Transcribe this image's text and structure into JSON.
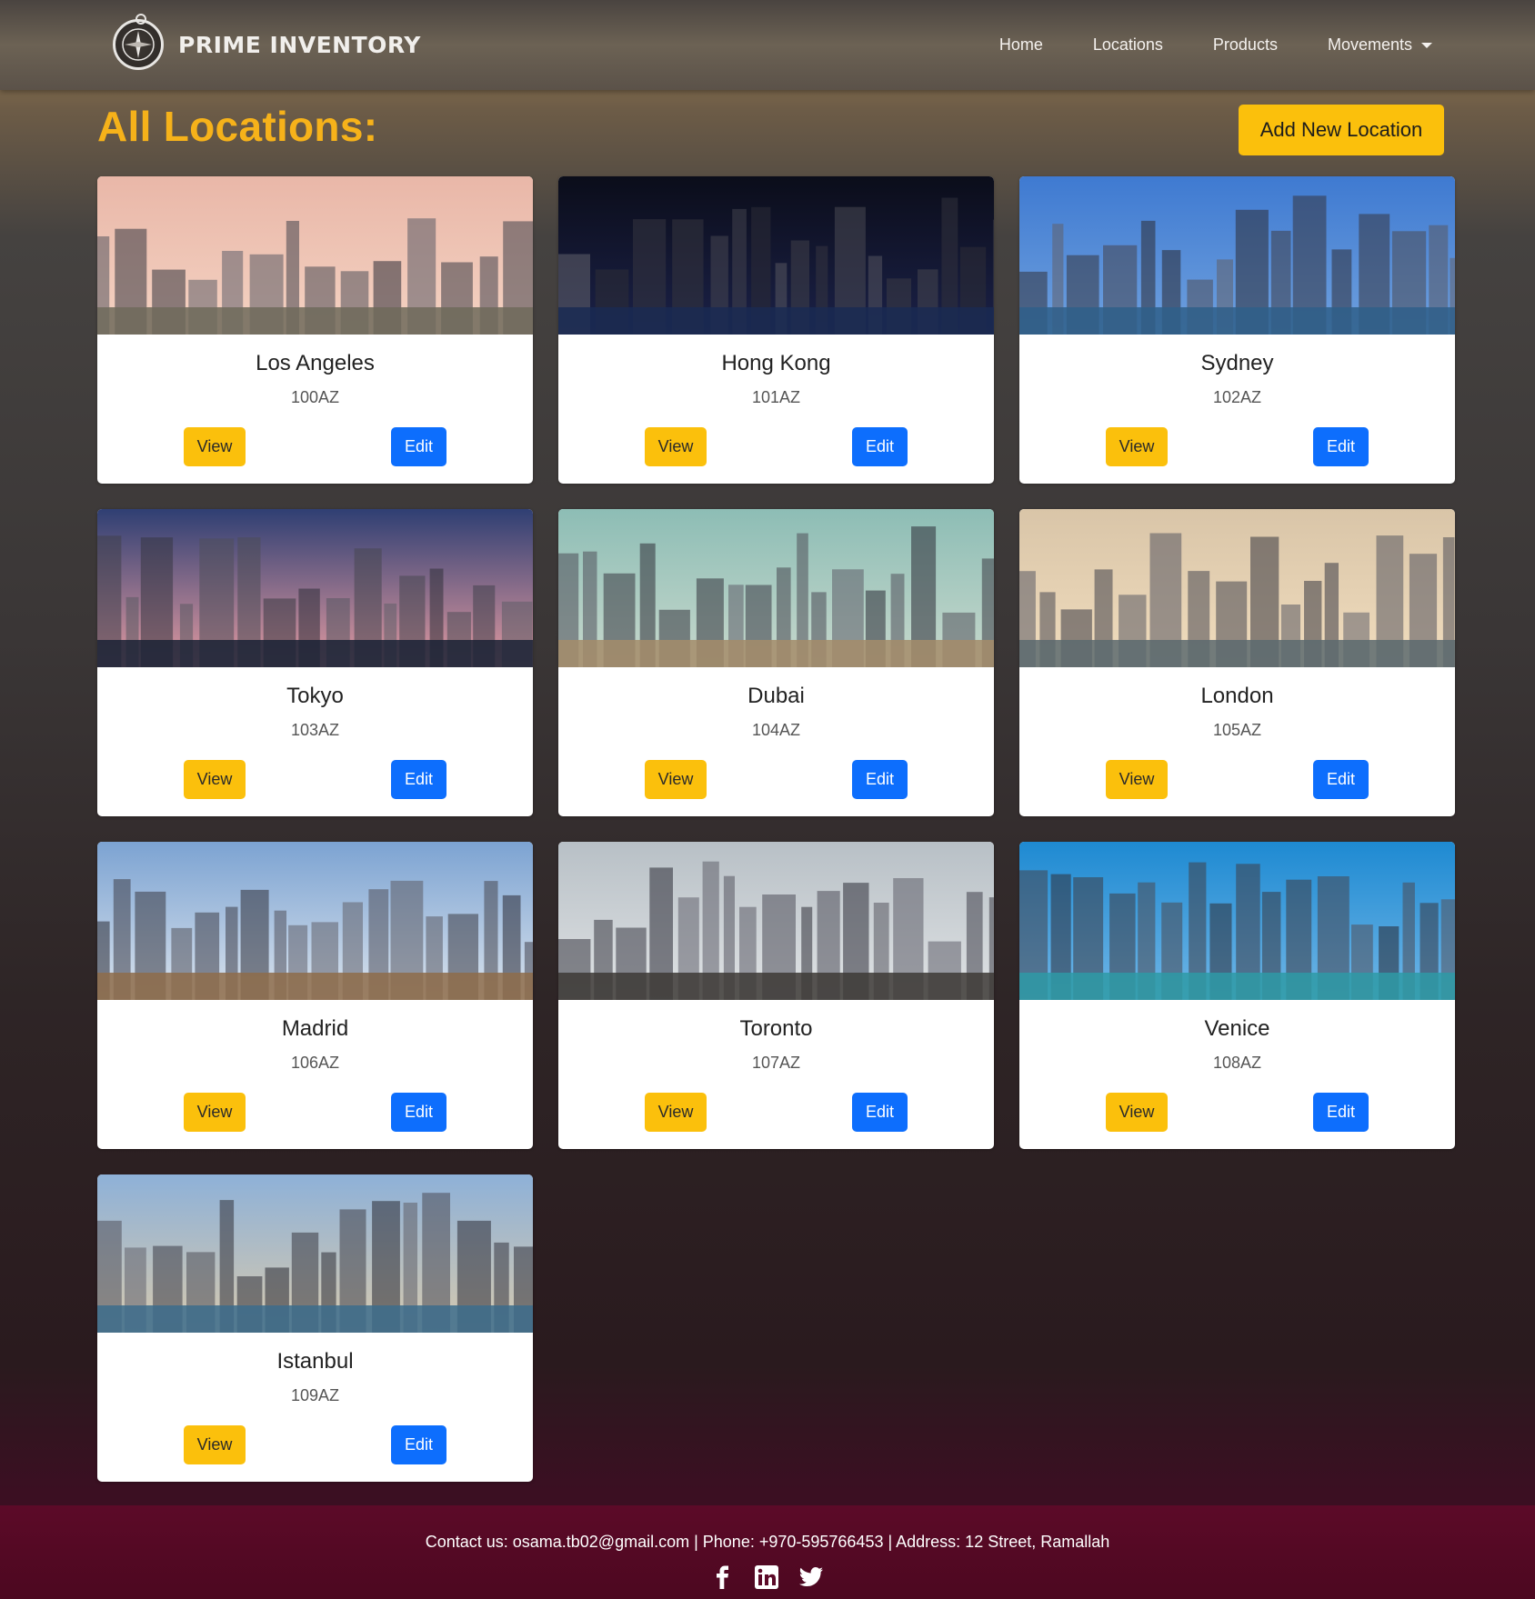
{
  "navbar": {
    "brand": "PRIME INVENTORY",
    "links": [
      {
        "label": "Home"
      },
      {
        "label": "Locations"
      },
      {
        "label": "Products"
      },
      {
        "label": "Movements"
      }
    ]
  },
  "header": {
    "title": "All Locations:",
    "add_button": "Add New Location"
  },
  "locations": [
    {
      "name": "Los Angeles",
      "code": "100AZ",
      "view": "View",
      "edit": "Edit",
      "sky": "#e9b7a8",
      "sky2": "#f4d2c2",
      "ground": "#6f6a5a"
    },
    {
      "name": "Hong Kong",
      "code": "101AZ",
      "view": "View",
      "edit": "Edit",
      "sky": "#0b0d1a",
      "sky2": "#1b2148",
      "ground": "#1a2a52"
    },
    {
      "name": "Sydney",
      "code": "102AZ",
      "view": "View",
      "edit": "Edit",
      "sky": "#3f7ad1",
      "sky2": "#6ea0de",
      "ground": "#2f5f8a"
    },
    {
      "name": "Tokyo",
      "code": "103AZ",
      "view": "View",
      "edit": "Edit",
      "sky": "#2f3f73",
      "sky2": "#e39aa0",
      "ground": "#1a2235"
    },
    {
      "name": "Dubai",
      "code": "104AZ",
      "view": "View",
      "edit": "Edit",
      "sky": "#8dbdb5",
      "sky2": "#c7d8cc",
      "ground": "#a48c6a"
    },
    {
      "name": "London",
      "code": "105AZ",
      "view": "View",
      "edit": "Edit",
      "sky": "#d9c5a8",
      "sky2": "#f0dcbd",
      "ground": "#5c6a6e"
    },
    {
      "name": "Madrid",
      "code": "106AZ",
      "view": "View",
      "edit": "Edit",
      "sky": "#7ca3d2",
      "sky2": "#d9e2ec",
      "ground": "#8e6c4a"
    },
    {
      "name": "Toronto",
      "code": "107AZ",
      "view": "View",
      "edit": "Edit",
      "sky": "#b8c0c6",
      "sky2": "#dfe2e4",
      "ground": "#3d3a36"
    },
    {
      "name": "Venice",
      "code": "108AZ",
      "view": "View",
      "edit": "Edit",
      "sky": "#1e8ad2",
      "sky2": "#6fb5e6",
      "ground": "#2e9aa6"
    },
    {
      "name": "Istanbul",
      "code": "109AZ",
      "view": "View",
      "edit": "Edit",
      "sky": "#8eb1d8",
      "sky2": "#d6c9ae",
      "ground": "#3c6c8c"
    }
  ],
  "footer": {
    "contact": "Contact us: osama.tb02@gmail.com | Phone: +970-595766453 | Address: 12 Street, Ramallah",
    "social": [
      "facebook-icon",
      "linkedin-icon",
      "twitter-icon"
    ]
  },
  "colors": {
    "accent_yellow": "#fbc00c",
    "primary_blue": "#0d6efd",
    "title_orange": "#f6b21a",
    "footer_bg": "#5c0a28"
  }
}
